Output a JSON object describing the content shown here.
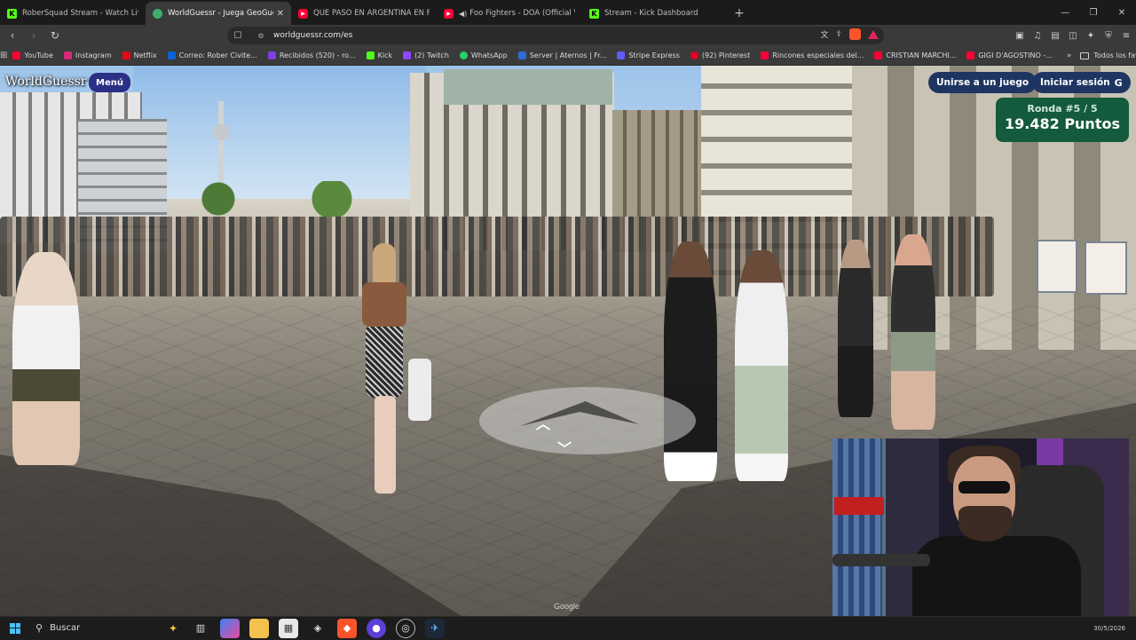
{
  "browser": {
    "tabs": [
      {
        "title": "RoberSquad Stream - Watch Live",
        "favicon": "kick-icon",
        "active": false
      },
      {
        "title": "WorldGuessr - Juega GeoGuessr",
        "favicon": "globe-icon",
        "active": true
      },
      {
        "title": "QUÉ PASÓ EN ARGENTINA EN FEBRE",
        "favicon": "youtube-icon",
        "active": false
      },
      {
        "title": "Foo Fighters - DOA (Official Vide",
        "favicon": "youtube-icon",
        "active": false
      },
      {
        "title": "Stream - Kick Dashboard",
        "favicon": "kick-icon",
        "active": false
      }
    ],
    "new_tab": "+",
    "url": "worldguessr.com/es",
    "bookmarks": [
      {
        "label": "YouTube",
        "color": "#ff0033"
      },
      {
        "label": "Instagram",
        "color": "#d62976"
      },
      {
        "label": "Netflix",
        "color": "#e50914"
      },
      {
        "label": "Correo: Rober Civite...",
        "color": "#0a64d6"
      },
      {
        "label": "Recibidos (520) - ro...",
        "color": "#7b3fe4"
      },
      {
        "label": "Kick",
        "color": "#53fc18"
      },
      {
        "label": "(2) Twitch",
        "color": "#9146ff"
      },
      {
        "label": "WhatsApp",
        "color": "#25d366"
      },
      {
        "label": "Server | Aternos | Fr...",
        "color": "#2a6fd6"
      },
      {
        "label": "Stripe Express",
        "color": "#635bff"
      },
      {
        "label": "(92) Pinterest",
        "color": "#e60023"
      },
      {
        "label": "Rincones especiales del...",
        "color": "#ff0033"
      },
      {
        "label": "CRISTIAN MARCHI...",
        "color": "#ff0033"
      },
      {
        "label": "GIGI D'AGOSTINO -...",
        "color": "#ff0033"
      }
    ],
    "bookmarks_more": "»",
    "all_favorites": "Todos los favoritos"
  },
  "game": {
    "logo": "WorldGuessr",
    "menu_label": "Menú",
    "join_label": "Unirse a un juego",
    "login_label": "Iniciar sesión",
    "round_label": "Ronda #5 / 5",
    "score_label": "19.482 Puntos",
    "watermark": "Google"
  },
  "taskbar": {
    "search_label": "Buscar",
    "date": "30/5/2026"
  },
  "colors": {
    "accent_menu": "#2b2f86",
    "score_box": "#145a3c",
    "buttons": "#1f3561"
  }
}
